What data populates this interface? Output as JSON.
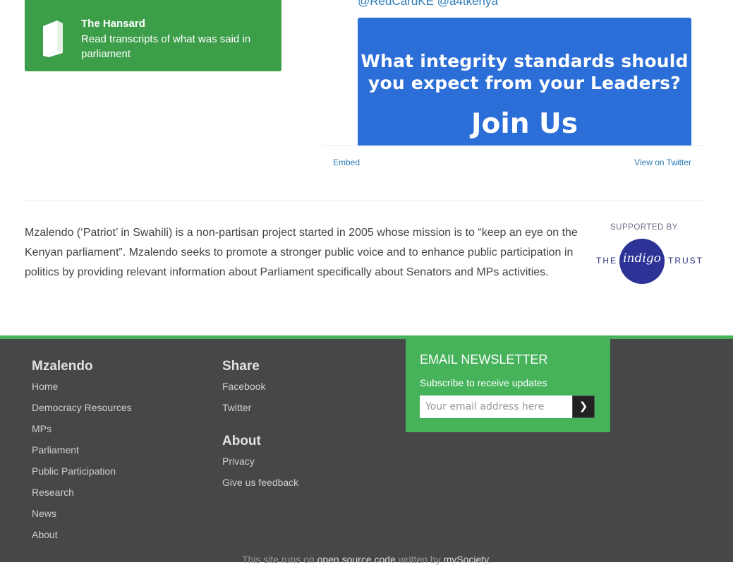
{
  "hansard": {
    "icon": "book-icon",
    "title": "The Hansard",
    "description": "Read transcripts of what was said in parliament"
  },
  "twitter": {
    "handles": "@RedCardKE @a4tkenya",
    "image_line1": "What integrity standards should",
    "image_line2": "you expect from your Leaders?",
    "image_line3": "Join Us",
    "embed_label": "Embed",
    "view_label": "View on Twitter"
  },
  "about_text": "Mzalendo (‘Patriot’ in Swahili) is a non-partisan project started in 2005 whose mission is to “keep an eye on the Kenyan parliament”. Mzalendo seeks to promote a stronger public voice and to enhance public participation in politics by providing relevant information about Parliament specifically about Senators and MPs activities.",
  "supporter": {
    "label": "SUPPORTED BY",
    "logo_the": "THE",
    "logo_indigo": "indigo",
    "logo_trust": "TRUST"
  },
  "footer": {
    "col1": {
      "heading": "Mzalendo",
      "links": [
        "Home",
        "Democracy Resources",
        "MPs",
        "Parliament",
        "Public Participation",
        "Research",
        "News",
        "About"
      ]
    },
    "share": {
      "heading": "Share",
      "links": [
        "Facebook",
        "Twitter"
      ]
    },
    "about": {
      "heading": "About",
      "links": [
        "Privacy",
        "Give us feedback"
      ]
    },
    "newsletter": {
      "heading": "EMAIL NEWSLETTER",
      "subtitle": "Subscribe to receive updates",
      "placeholder": "Your email address here",
      "submit_glyph": "❯"
    },
    "credits": {
      "prefix": "This site runs on ",
      "link1": "open source code",
      "middle": " written by ",
      "link2": "mySociety",
      "suffix": "."
    }
  },
  "colors": {
    "green": "#3d9e4a",
    "footer_green": "#46b35a",
    "footer_bg": "#474747",
    "twitter_blue": "#2b7bb9",
    "banner_blue": "#2c6ed8",
    "indigo": "#2d3296"
  }
}
